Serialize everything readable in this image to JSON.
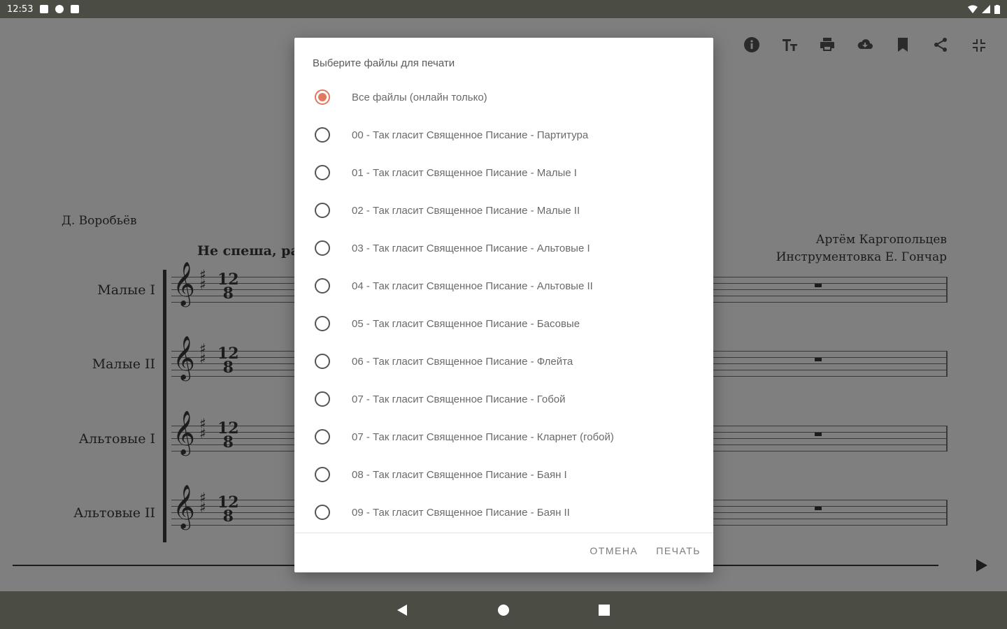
{
  "status_bar": {
    "time": "12:53"
  },
  "score": {
    "composer_left": "Д. Воробьёв",
    "tempo": "Не спеша, ра",
    "composer_right_line1": "Артём Каргопольцев",
    "composer_right_line2": "Инструментовка Е. Гончар",
    "staves": [
      {
        "label": "Малые I",
        "time_top": "12",
        "time_bottom": "8"
      },
      {
        "label": "Малые II",
        "time_top": "12",
        "time_bottom": "8"
      },
      {
        "label": "Альтовые I",
        "time_top": "12",
        "time_bottom": "8"
      },
      {
        "label": "Альтовые II",
        "time_top": "12",
        "time_bottom": "8"
      }
    ]
  },
  "toolbar": {
    "icons": [
      "info-icon",
      "text-size-icon",
      "print-icon",
      "cloud-download-icon",
      "bookmark-icon",
      "share-icon",
      "fullscreen-exit-icon"
    ]
  },
  "dialog": {
    "title": "Выберите файлы для печати",
    "selected_index": 0,
    "options": [
      "Все файлы (онлайн только)",
      "00 - Так гласит Священное Писание - Партитура",
      "01 - Так гласит Священное Писание - Малые I",
      "02 -  Так гласит Священное Писание - Малые II",
      "03 - Так гласит Священное Писание - Альтовые I",
      "04 - Так гласит Священное Писание - Альтовые II",
      "05 - Так гласит Священное Писание - Басовые",
      "06 - Так гласит Священное Писание - Флейта",
      "07 - Так гласит Священное Писание - Гобой",
      "07 - Так гласит Священное Писание - Кларнет (гобой)",
      "08 - Так гласит Священное Писание - Баян I",
      "09 - Так гласит Священное Писание - Баян II"
    ],
    "cancel_label": "ОТМЕНА",
    "print_label": "ПЕЧАТЬ"
  },
  "colors": {
    "accent": "#e07a5f",
    "system_bar": "#4b4d44",
    "scrim": "#7f7f7f"
  }
}
